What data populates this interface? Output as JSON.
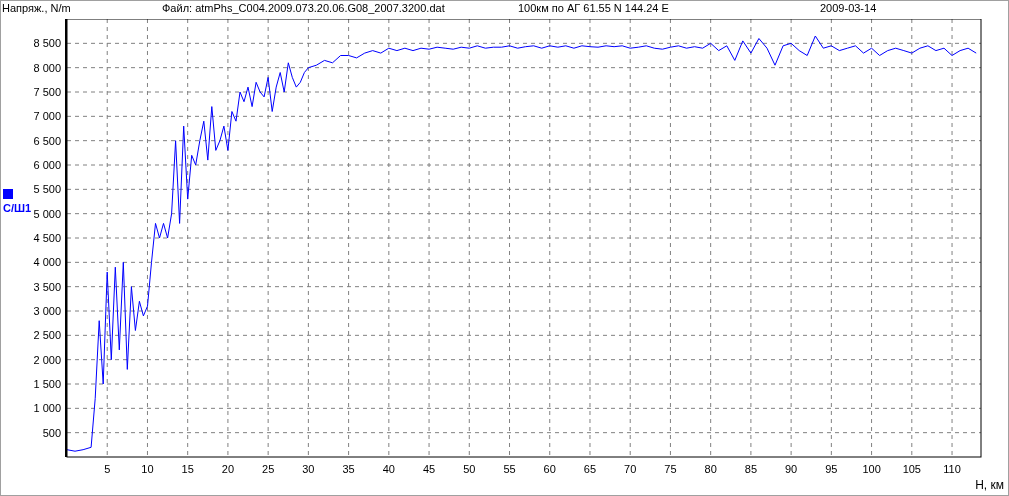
{
  "header": {
    "file": "Файл: atmPhs_C004.2009.073.20.06.G08_2007.3200.dat",
    "location": "100км по АГ 61.55 N  144.24 E",
    "date": "2009-03-14"
  },
  "chart_data": {
    "type": "line",
    "grid": true,
    "xlabel": "H, км",
    "ylabel": "Напряж., N/m",
    "xlim": [
      0,
      113.6
    ],
    "ylim": [
      0,
      9000
    ],
    "xticks": [
      5,
      10,
      15,
      20,
      25,
      30,
      35,
      40,
      45,
      50,
      55,
      60,
      65,
      70,
      75,
      80,
      85,
      90,
      95,
      100,
      105,
      110
    ],
    "yticks": [
      {
        "value": 500,
        "label": "500"
      },
      {
        "value": 1000,
        "label": "1 000"
      },
      {
        "value": 1500,
        "label": "1 500"
      },
      {
        "value": 2000,
        "label": "2 000"
      },
      {
        "value": 2500,
        "label": "2 500"
      },
      {
        "value": 3000,
        "label": "3 000"
      },
      {
        "value": 3500,
        "label": "3 500"
      },
      {
        "value": 4000,
        "label": "4 000"
      },
      {
        "value": 4500,
        "label": "4 500"
      },
      {
        "value": 5000,
        "label": "5 000"
      },
      {
        "value": 5500,
        "label": "5 500"
      },
      {
        "value": 6000,
        "label": "6 000"
      },
      {
        "value": 6500,
        "label": "6 500"
      },
      {
        "value": 7000,
        "label": "7 000"
      },
      {
        "value": 7500,
        "label": "7 500"
      },
      {
        "value": 8000,
        "label": "8 000"
      },
      {
        "value": 8500,
        "label": "8 500"
      }
    ],
    "x": [
      0,
      1,
      2,
      3,
      3.5,
      4,
      4.5,
      5,
      5.5,
      6,
      6.5,
      7,
      7.5,
      8,
      8.5,
      9,
      9.5,
      10,
      10.5,
      11,
      11.5,
      12,
      12.5,
      13,
      13.5,
      14,
      14.5,
      15,
      15.5,
      16,
      16.5,
      17,
      17.5,
      18,
      18.5,
      19,
      19.5,
      20,
      20.5,
      21,
      21.5,
      22,
      22.5,
      23,
      23.5,
      24,
      24.5,
      25,
      25.5,
      26,
      26.5,
      27,
      27.5,
      28,
      28.5,
      29,
      29.5,
      30,
      31,
      32,
      33,
      34,
      35,
      36,
      37,
      38,
      39,
      40,
      41,
      42,
      43,
      44,
      45,
      46,
      47,
      48,
      49,
      50,
      51,
      52,
      53,
      54,
      55,
      56,
      57,
      58,
      59,
      60,
      61,
      62,
      63,
      64,
      65,
      66,
      67,
      68,
      69,
      70,
      71,
      72,
      73,
      74,
      75,
      76,
      77,
      78,
      79,
      80,
      81,
      82,
      83,
      84,
      85,
      86,
      87,
      88,
      89,
      90,
      91,
      92,
      93,
      94,
      95,
      96,
      97,
      98,
      99,
      100,
      101,
      102,
      103,
      104,
      105,
      106,
      107,
      108,
      109,
      110,
      111,
      112,
      113
    ],
    "series": [
      {
        "name": "С/Ш1",
        "color": "#0000ff",
        "values": [
          150,
          120,
          150,
          200,
          1200,
          2800,
          1500,
          3800,
          2000,
          3900,
          2200,
          4000,
          1800,
          3500,
          2600,
          3200,
          2900,
          3100,
          4000,
          4800,
          4500,
          4800,
          4500,
          5000,
          6500,
          4800,
          6800,
          5300,
          6200,
          6000,
          6500,
          6900,
          6100,
          7200,
          6300,
          6500,
          6800,
          6300,
          7100,
          6900,
          7500,
          7300,
          7600,
          7200,
          7700,
          7500,
          7400,
          7800,
          7100,
          7600,
          7900,
          7500,
          8100,
          7800,
          7600,
          7700,
          7900,
          8000,
          8050,
          8150,
          8100,
          8250,
          8250,
          8200,
          8300,
          8350,
          8300,
          8400,
          8350,
          8400,
          8350,
          8400,
          8380,
          8420,
          8400,
          8380,
          8420,
          8400,
          8450,
          8400,
          8420,
          8420,
          8450,
          8400,
          8430,
          8450,
          8400,
          8450,
          8420,
          8450,
          8400,
          8450,
          8430,
          8420,
          8450,
          8430,
          8450,
          8400,
          8420,
          8450,
          8400,
          8380,
          8420,
          8450,
          8400,
          8430,
          8400,
          8500,
          8350,
          8450,
          8150,
          8550,
          8300,
          8600,
          8400,
          8050,
          8450,
          8500,
          8350,
          8250,
          8650,
          8400,
          8450,
          8350,
          8400,
          8450,
          8300,
          8400,
          8250,
          8350,
          8400,
          8350,
          8300,
          8400,
          8450,
          8350,
          8400,
          8250,
          8350,
          8400,
          8300
        ]
      }
    ]
  }
}
